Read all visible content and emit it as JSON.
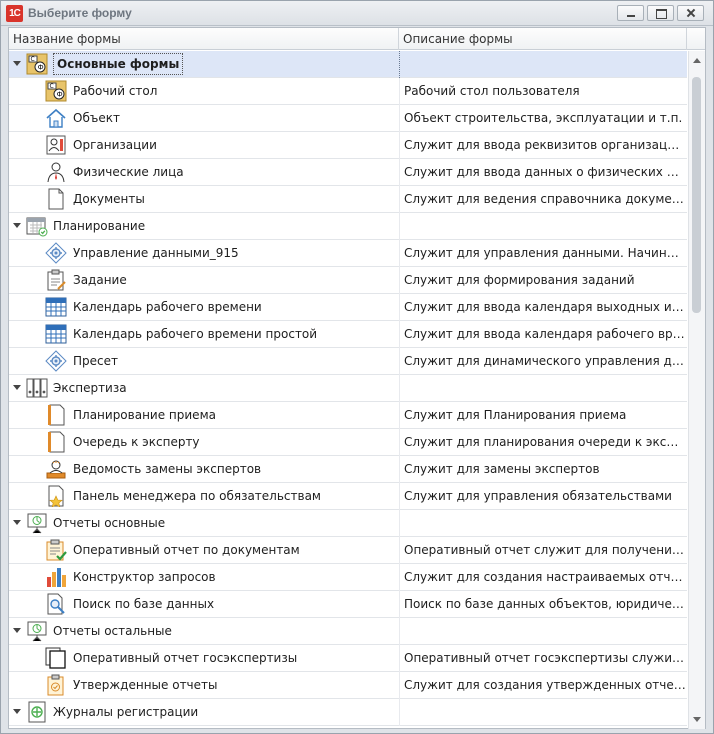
{
  "window": {
    "title": "Выберите форму",
    "app_icon_text": "1C"
  },
  "columns": {
    "name": "Название формы",
    "description": "Описание формы"
  },
  "rows": [
    {
      "type": "group",
      "label": "Основные формы",
      "icon": "main-forms-icon",
      "desc": "",
      "selected": true
    },
    {
      "type": "item",
      "label": "Рабочий стол",
      "icon": "desktop-icon",
      "desc": "Рабочий стол пользователя"
    },
    {
      "type": "item",
      "label": "Объект",
      "icon": "house-icon",
      "desc": "Объект строительства, эксплуатации и т.п."
    },
    {
      "type": "item",
      "label": "Организации",
      "icon": "organization-icon",
      "desc": "Служит для ввода реквизитов организации и в..."
    },
    {
      "type": "item",
      "label": "Физические лица",
      "icon": "person-icon",
      "desc": "Служит для ввода данных о физических лицах"
    },
    {
      "type": "item",
      "label": "Документы",
      "icon": "document-icon",
      "desc": "Служит для ведения справочника документов"
    },
    {
      "type": "group",
      "label": "Планирование",
      "icon": "planning-calendar-icon",
      "desc": ""
    },
    {
      "type": "item",
      "label": "Управление данными_915",
      "icon": "gear-diamond-icon",
      "desc": "Служит для управления данными. Начиная с в..."
    },
    {
      "type": "item",
      "label": "Задание",
      "icon": "task-clipboard-icon",
      "desc": "Служит для формирования заданий"
    },
    {
      "type": "item",
      "label": "Календарь рабочего времени",
      "icon": "calendar-icon",
      "desc": "Служит для ввода календаря выходных и рабо..."
    },
    {
      "type": "item",
      "label": "Календарь рабочего времени простой",
      "icon": "calendar-icon",
      "desc": "Служит для ввода календаря рабочего времен..."
    },
    {
      "type": "item",
      "label": "Пресет",
      "icon": "gear-diamond-icon",
      "desc": "Служит для динамического управления данны..."
    },
    {
      "type": "group",
      "label": "Экспертиза",
      "icon": "binders-icon",
      "desc": ""
    },
    {
      "type": "item",
      "label": "Планирование приема",
      "icon": "notebook-icon",
      "desc": "Служит для Планирования приема"
    },
    {
      "type": "item",
      "label": "Очередь к эксперту",
      "icon": "notebook-icon",
      "desc": "Служит для планирования очереди к эксперту"
    },
    {
      "type": "item",
      "label": "Ведомость замены экспертов",
      "icon": "user-tray-icon",
      "desc": "Служит для замены экспертов"
    },
    {
      "type": "item",
      "label": "Панель менеджера по обязательствам",
      "icon": "star-document-icon",
      "desc": "Служит для управления обязательствами"
    },
    {
      "type": "group",
      "label": "Отчеты основные",
      "icon": "presentation-icon",
      "desc": ""
    },
    {
      "type": "item",
      "label": "Оперативный отчет по документам",
      "icon": "check-clipboard-icon",
      "desc": "Оперативный отчет служит для получения оп..."
    },
    {
      "type": "item",
      "label": "Конструктор запросов",
      "icon": "bar-chart-icon",
      "desc": "Служит для создания настраиваемых отчетов..."
    },
    {
      "type": "item",
      "label": "Поиск по базе данных",
      "icon": "search-document-icon",
      "desc": "Поиск по базе данных объектов, юридических,..."
    },
    {
      "type": "group",
      "label": "Отчеты остальные",
      "icon": "presentation-icon",
      "desc": ""
    },
    {
      "type": "item",
      "label": "Оперативный отчет госэкспертизы",
      "icon": "pages-icon",
      "desc": "Оперативный отчет госэкспертизы служит дл..."
    },
    {
      "type": "item",
      "label": "Утвержденные отчеты",
      "icon": "approved-clipboard-icon",
      "desc": "Служит для создания утвержденных отчетов"
    },
    {
      "type": "group",
      "label": "Журналы регистрации",
      "icon": "journal-icon",
      "desc": ""
    }
  ]
}
